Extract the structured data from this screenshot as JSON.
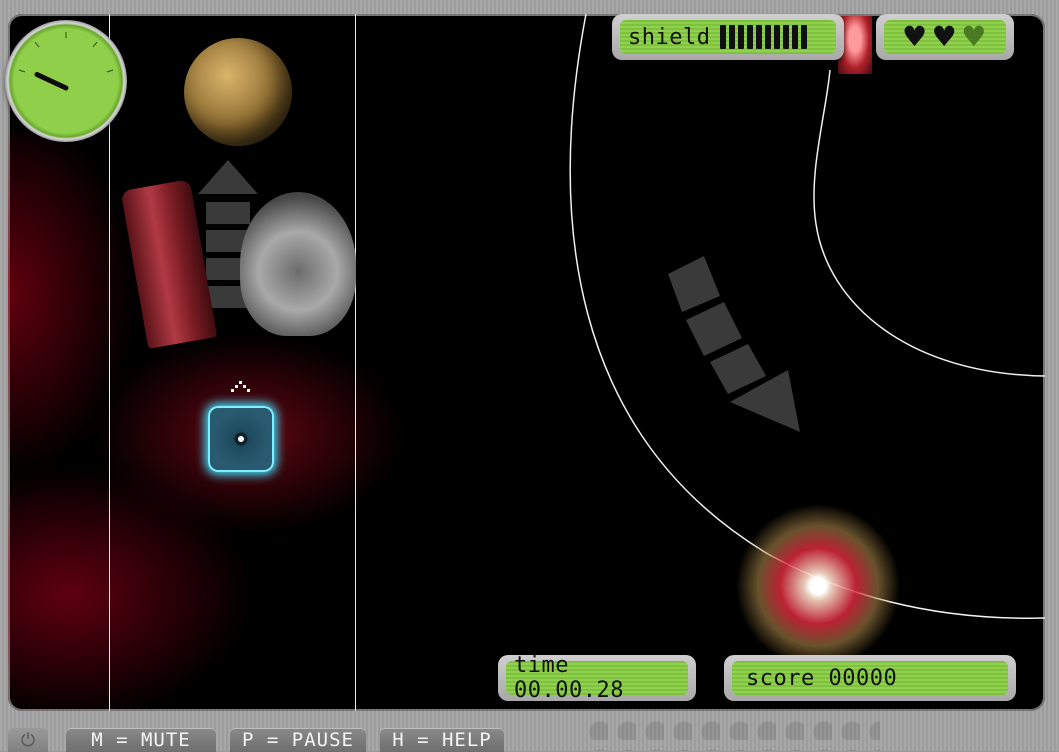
{
  "hud": {
    "shield_label": "shield",
    "shield_bars_total": 10,
    "shield_bars_filled": 10,
    "lives_total": 3,
    "lives_remaining": 2,
    "time_label": "time 00.00.28",
    "score_label": "score 00000"
  },
  "speed_gauge": {
    "needle_angle_deg": -65
  },
  "controls": {
    "power_icon": "⏻",
    "mute": "M = MUTE",
    "pause": "P = PAUSE",
    "help": "H = HELP"
  },
  "colors": {
    "hud_green": "#7ec13e",
    "player_glow": "#3ee0ff",
    "nebula_red": "#b0101e"
  }
}
